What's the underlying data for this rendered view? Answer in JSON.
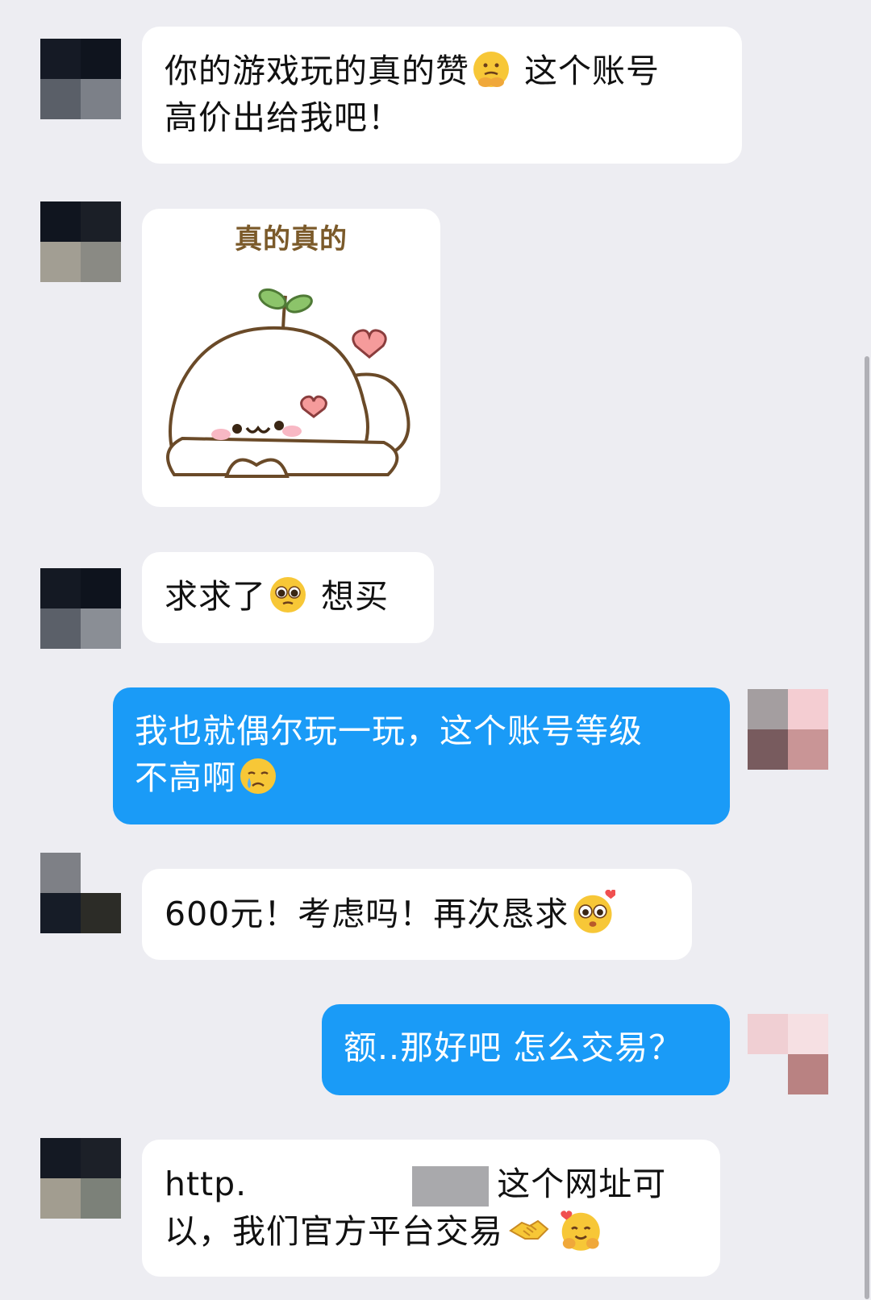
{
  "messages": [
    {
      "id": "m1",
      "side": "in",
      "text_a": "你的游戏玩的真的赞",
      "emoji_1": "thinking-face-emoji",
      "text_b": " 这个账号",
      "text_c": "高价出给我吧！"
    },
    {
      "id": "m2",
      "side": "in",
      "type": "sticker",
      "caption": "真的真的",
      "sticker": "cute-white-blob-heart-sticker"
    },
    {
      "id": "m3",
      "side": "in",
      "text_a": "求求了",
      "emoji_1": "pleading-face-emoji",
      "text_b": " 想买"
    },
    {
      "id": "m4",
      "side": "out",
      "text_a": "我也就偶尔玩一玩，这个账号等级",
      "text_b": "不高啊",
      "emoji_1": "crying-face-emoji"
    },
    {
      "id": "m5",
      "side": "in",
      "text_a": "600元！考虑吗！再次恳求",
      "emoji_1": "starry-heart-face-emoji"
    },
    {
      "id": "m6",
      "side": "out",
      "text_a": "额..那好吧 怎么交易？"
    },
    {
      "id": "m7",
      "side": "in",
      "text_a": "http.",
      "text_b": "这个网址可",
      "text_c": "以，我们官方平台交易",
      "emoji_1": "handshake-emoji",
      "emoji_2": "hugging-face-emoji"
    }
  ],
  "colors": {
    "background": "#ededf2",
    "incoming_bubble": "#ffffff",
    "outgoing_bubble": "#1a9bf7"
  }
}
